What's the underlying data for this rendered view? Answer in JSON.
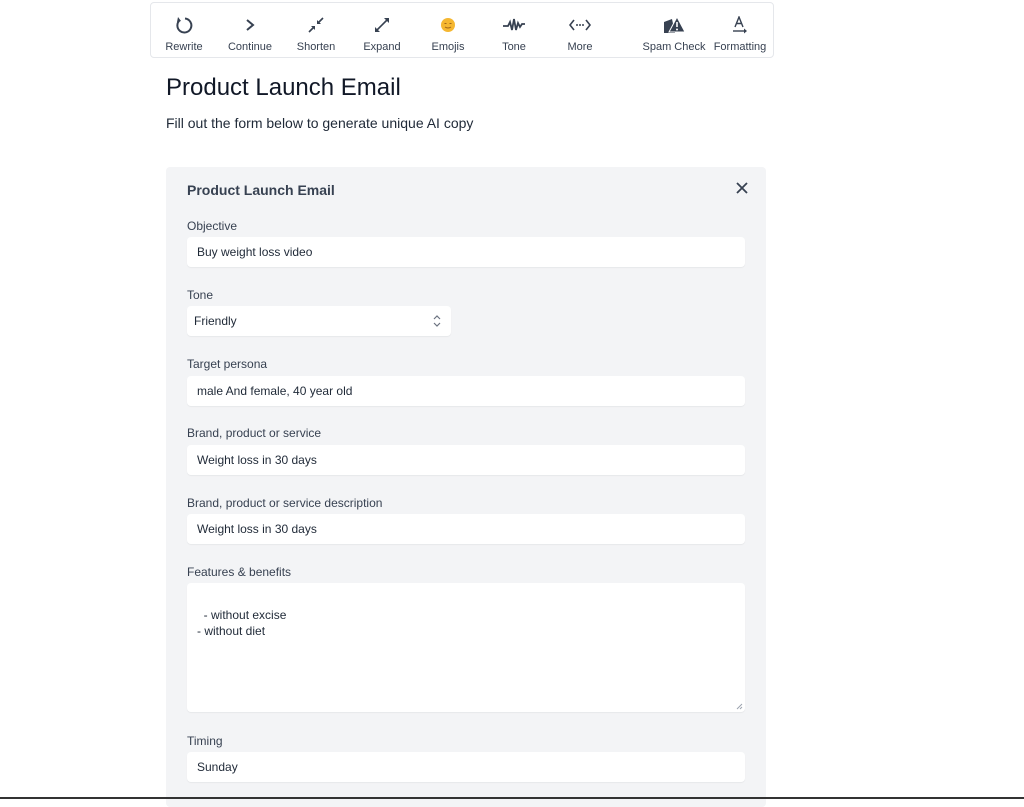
{
  "toolbar": {
    "items": [
      {
        "label": "Rewrite",
        "icon": "rewrite-icon"
      },
      {
        "label": "Continue",
        "icon": "chevron-right-icon"
      },
      {
        "label": "Shorten",
        "icon": "shrink-icon"
      },
      {
        "label": "Expand",
        "icon": "expand-icon"
      },
      {
        "label": "Emojis",
        "icon": "emoji-icon"
      },
      {
        "label": "Tone",
        "icon": "waveform-icon"
      },
      {
        "label": "More",
        "icon": "more-icon"
      },
      {
        "label": "Spam Check",
        "icon": "spam-warning-icon"
      },
      {
        "label": "Formatting",
        "icon": "formatting-icon"
      }
    ]
  },
  "page": {
    "title": "Product Launch Email",
    "subtitle": "Fill out the form below to generate unique AI copy"
  },
  "form": {
    "title": "Product Launch Email",
    "objective": {
      "label": "Objective",
      "value": "Buy weight loss video"
    },
    "tone": {
      "label": "Tone",
      "value": "Friendly"
    },
    "persona": {
      "label": "Target persona",
      "value": "male And female, 40 year old"
    },
    "brand": {
      "label": "Brand, product or service",
      "value": "Weight loss in 30 days"
    },
    "description": {
      "label": "Brand, product or service description",
      "value": "Weight loss in 30 days"
    },
    "features": {
      "label": "Features & benefits",
      "value": "- without excise\n- without diet"
    },
    "timing": {
      "label": "Timing",
      "value": "Sunday"
    }
  },
  "colors": {
    "card_bg": "#f3f4f6",
    "icon": "#374151",
    "emoji": "#f5b731"
  }
}
